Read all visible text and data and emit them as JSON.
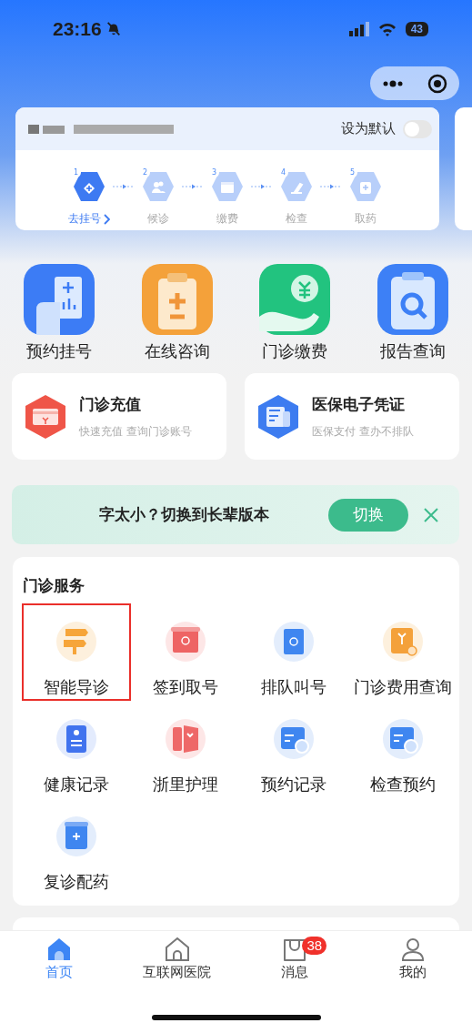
{
  "status_bar": {
    "time": "23:16",
    "battery": "43"
  },
  "patient_card": {
    "default_label": "设为默认",
    "default_on": false,
    "steps": [
      {
        "number": "1",
        "label": "去挂号",
        "selected": true
      },
      {
        "number": "2",
        "label": "候诊",
        "selected": false
      },
      {
        "number": "3",
        "label": "缴费",
        "selected": false
      },
      {
        "number": "4",
        "label": "检查",
        "selected": false
      },
      {
        "number": "5",
        "label": "取药",
        "selected": false
      }
    ]
  },
  "quick_actions": [
    {
      "label": "预约挂号"
    },
    {
      "label": "在线咨询"
    },
    {
      "label": "门诊缴费"
    },
    {
      "label": "报告查询"
    }
  ],
  "feature_cards": [
    {
      "title": "门诊充值",
      "subtitle": "快速充值 查询门诊账号"
    },
    {
      "title": "医保电子凭证",
      "subtitle": "医保支付 查办不排队"
    }
  ],
  "elder_banner": {
    "text": "字太小？切换到长辈版本",
    "button": "切换"
  },
  "outpatient_services": {
    "title": "门诊服务",
    "items": [
      {
        "label": "智能导诊",
        "highlighted": true
      },
      {
        "label": "签到取号",
        "highlighted": false
      },
      {
        "label": "排队叫号",
        "highlighted": false
      },
      {
        "label": "门诊费用查询",
        "highlighted": false
      },
      {
        "label": "健康记录",
        "highlighted": false
      },
      {
        "label": "浙里护理",
        "highlighted": false
      },
      {
        "label": "预约记录",
        "highlighted": false
      },
      {
        "label": "检查预约",
        "highlighted": false
      },
      {
        "label": "复诊配药",
        "highlighted": false
      }
    ]
  },
  "tab_bar": [
    {
      "label": "首页",
      "selected": true
    },
    {
      "label": "互联网医院",
      "selected": false
    },
    {
      "label": "消息",
      "selected": false,
      "badge": "38"
    },
    {
      "label": "我的",
      "selected": false
    }
  ]
}
